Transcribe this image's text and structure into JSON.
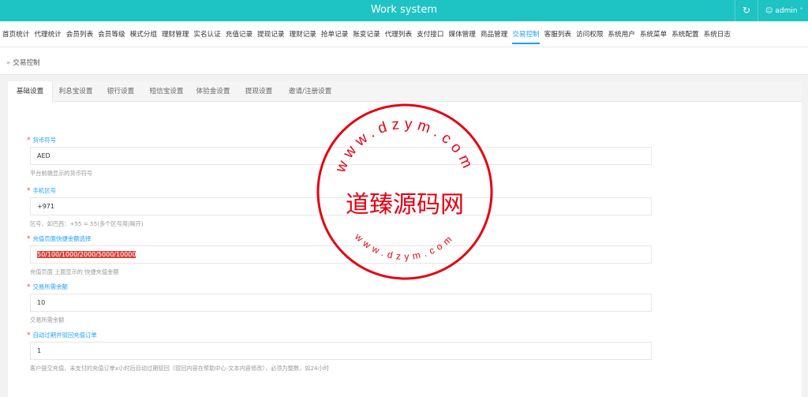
{
  "header": {
    "title": "Work system",
    "refresh_icon": "refresh-icon",
    "user_label": "admin",
    "user_icon": "user-icon"
  },
  "nav": {
    "items": [
      "首页统计",
      "代理统计",
      "会员列表",
      "会员等级",
      "模式分组",
      "理财管理",
      "实名认证",
      "充值记录",
      "提现记录",
      "理财记录",
      "抢单记录",
      "账变记录",
      "代理列表",
      "支付接口",
      "媒体管理",
      "商品管理",
      "交易控制",
      "客服列表",
      "访问权限",
      "系统用户",
      "系统菜单",
      "系统配置",
      "系统日志"
    ],
    "active": "交易控制"
  },
  "breadcrumb": {
    "sep": "»",
    "label": "交易控制"
  },
  "tabs": [
    "基础设置",
    "利息宝设置",
    "银行设置",
    "短信宝设置",
    "体验金设置",
    "提现设置",
    "邀请/注册设置"
  ],
  "form": {
    "fields": [
      {
        "label": "货币符号",
        "value": "AED",
        "help": "平台前端显示的货币符号"
      },
      {
        "label": "手机区号",
        "value": "+971",
        "help": "区号，如巴西：+55 = 55(多个区号用|隔开)"
      },
      {
        "label": "充值页面快捷金额选择",
        "value": "50/100/1000/2000/5000/10000",
        "help": "充值页面 上面显示的 快捷充值金额"
      },
      {
        "label": "交易所需余额",
        "value": "10",
        "help": "交易所需余额"
      },
      {
        "label": "自动过期并驳回充值订单",
        "value": "1",
        "help": "客户提交充值，未支付的充值订单x小时后自动过期驳回（驳回内容在帮助中心-文本内容修改），必须为整数，如24小时"
      }
    ]
  },
  "watermark": {
    "center_text": "道臻源码网",
    "top_arc": "www.dzym.com",
    "bottom_arc": "www.dzym.com",
    "color": "#e60012"
  },
  "colors": {
    "header": "#1ec3c3",
    "accent": "#1e9fff",
    "required": "#ff4040"
  }
}
